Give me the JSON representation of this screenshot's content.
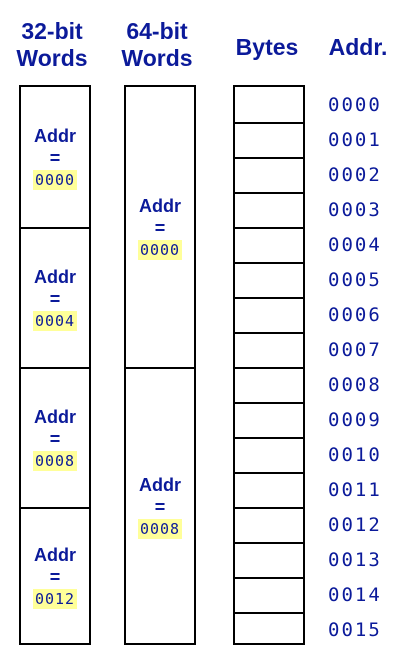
{
  "headers": {
    "words32": [
      "32-bit",
      "Words"
    ],
    "words64": [
      "64-bit",
      "Words"
    ],
    "bytes": "Bytes",
    "addr": "Addr."
  },
  "words32": [
    {
      "label": "Addr",
      "eq": "=",
      "value": "0000"
    },
    {
      "label": "Addr",
      "eq": "=",
      "value": "0004"
    },
    {
      "label": "Addr",
      "eq": "=",
      "value": "0008"
    },
    {
      "label": "Addr",
      "eq": "=",
      "value": "0012"
    }
  ],
  "words64": [
    {
      "label": "Addr",
      "eq": "=",
      "value": "0000"
    },
    {
      "label": "Addr",
      "eq": "=",
      "value": "0008"
    }
  ],
  "addresses": [
    "0000",
    "0001",
    "0002",
    "0003",
    "0004",
    "0005",
    "0006",
    "0007",
    "0008",
    "0009",
    "0010",
    "0011",
    "0012",
    "0013",
    "0014",
    "0015"
  ],
  "colors": {
    "text": "#0b1a9a",
    "highlight": "#ffff99",
    "border": "#000000"
  }
}
